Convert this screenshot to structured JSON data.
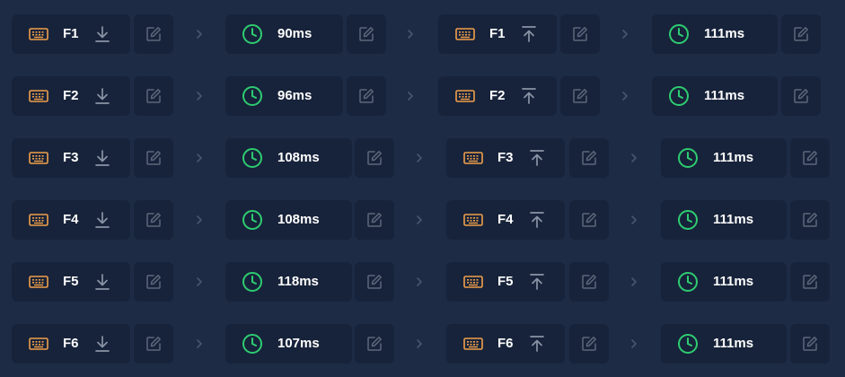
{
  "colors": {
    "background": "#1d2b45",
    "chip": "#17233a",
    "keyboard_icon": "#f0a04b",
    "clock_icon": "#2ecc71",
    "muted_icon": "#8a94a6",
    "label": "#ffffff"
  },
  "icons": {
    "keyboard": "keyboard-icon",
    "press": "download-icon",
    "release": "upload-icon",
    "delay": "clock-icon",
    "edit": "edit-icon",
    "separator": "chevron-right-icon"
  },
  "macro_steps": [
    {
      "key_down": "F1",
      "delay_after_down": "90ms",
      "key_up": "F1",
      "delay_after_up": "111ms"
    },
    {
      "key_down": "F2",
      "delay_after_down": "96ms",
      "key_up": "F2",
      "delay_after_up": "111ms"
    },
    {
      "key_down": "F3",
      "delay_after_down": "108ms",
      "key_up": "F3",
      "delay_after_up": "111ms"
    },
    {
      "key_down": "F4",
      "delay_after_down": "108ms",
      "key_up": "F4",
      "delay_after_up": "111ms"
    },
    {
      "key_down": "F5",
      "delay_after_down": "118ms",
      "key_up": "F5",
      "delay_after_up": "111ms"
    },
    {
      "key_down": "F6",
      "delay_after_down": "107ms",
      "key_up": "F6",
      "delay_after_up": "111ms"
    }
  ]
}
